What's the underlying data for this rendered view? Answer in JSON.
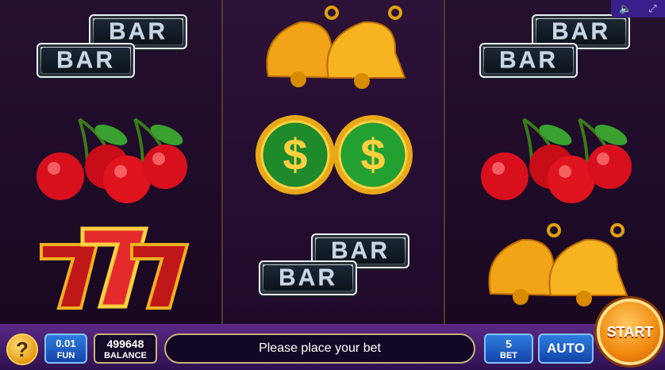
{
  "header": {
    "sound_icon": "speaker-icon",
    "fullscreen_icon": "fullscreen-icon"
  },
  "reels": [
    [
      "bar",
      "cherries",
      "sevens"
    ],
    [
      "bells",
      "dollar-coins",
      "bar"
    ],
    [
      "bar",
      "cherries",
      "bells"
    ]
  ],
  "symbols": {
    "bar_label": "BAR",
    "dollar_label": "$",
    "seven_label": "7"
  },
  "hud": {
    "help_label": "?",
    "denomination_value": "0.01",
    "denomination_label": "FUN",
    "balance_value": "499648",
    "balance_label": "BALANCE",
    "message": "Please place your bet",
    "bet_value": "5",
    "bet_label": "BET",
    "auto_label": "AUTO",
    "start_label": "START"
  },
  "colors": {
    "accent_gold": "#f0a020",
    "button_blue": "#1e5cc8",
    "panel_purple": "#4a1f78"
  }
}
